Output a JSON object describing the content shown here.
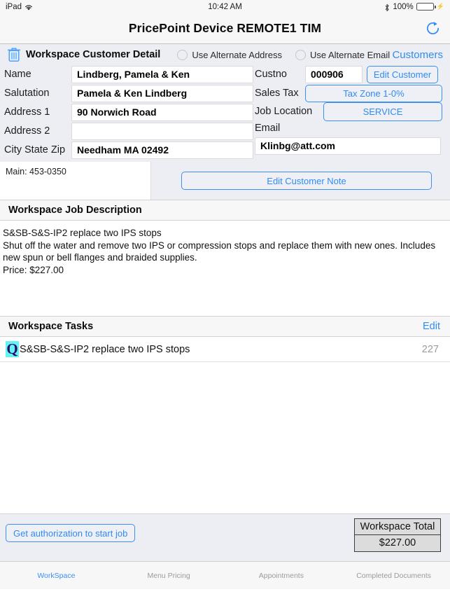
{
  "status_bar": {
    "device": "iPad",
    "wifi_icon": "wifi-icon",
    "time": "10:42 AM",
    "bluetooth_icon": "bluetooth-icon",
    "battery_percent": "100%",
    "battery_icon": "battery-charging-icon"
  },
  "nav": {
    "title": "PricePoint Device REMOTE1 TIM",
    "refresh_icon": "refresh-icon"
  },
  "customer_panel": {
    "trash_icon": "trash-icon",
    "title": "Workspace Customer Detail",
    "alt_address_label": "Use Alternate Address",
    "alt_address_checked": false,
    "alt_email_label": "Use Alternate Email",
    "alt_email_checked": false,
    "customers_link": "Customers",
    "fields": [
      {
        "label": "Name",
        "value": "Lindberg, Pamela & Ken"
      },
      {
        "label": "Salutation",
        "value": "Pamela & Ken Lindberg"
      },
      {
        "label": "Address 1",
        "value": "90 Norwich Road"
      },
      {
        "label": "Address 2",
        "value": ""
      },
      {
        "label": "City State Zip",
        "value": "Needham MA 02492"
      }
    ],
    "custno_label": "Custno",
    "custno_value": "000906",
    "edit_customer_label": "Edit Customer",
    "sales_tax_label": "Sales Tax",
    "tax_zone_value": "Tax Zone 1-0%",
    "job_location_label": "Job Location",
    "job_location_value": "SERVICE",
    "email_label": "Email",
    "email_value": "Klinbg@att.com",
    "phone_note": "Main: 453-0350",
    "edit_note_label": "Edit Customer Note"
  },
  "job_description": {
    "header": "Workspace Job Description",
    "line1": "S&SB-S&S-IP2 replace two IPS stops",
    "line2": "Shut off the water and remove two IPS or compression stops and replace them with new ones. Includes new spun or bell flanges and braided supplies.",
    "line3": "Price: $227.00"
  },
  "tasks": {
    "header": "Workspace Tasks",
    "edit_label": "Edit",
    "rows": [
      {
        "badge": "Q",
        "title": "S&SB-S&S-IP2 replace two IPS stops",
        "amount": "227"
      }
    ]
  },
  "footer": {
    "auth_button": "Get authorization to start job",
    "total_label": "Workspace Total",
    "total_value": "$227.00"
  },
  "tab_bar": {
    "items": [
      {
        "label": "WorkSpace",
        "active": true
      },
      {
        "label": "Menu Pricing",
        "active": false
      },
      {
        "label": "Appointments",
        "active": false
      },
      {
        "label": "Completed Documents",
        "active": false
      }
    ]
  },
  "colors": {
    "accent_blue": "#2f8bf5",
    "panel_bg": "#eceef3",
    "badge_bg": "#63f4f4",
    "badge_fg": "#2b0a6b",
    "battery_green": "#4cd964"
  }
}
